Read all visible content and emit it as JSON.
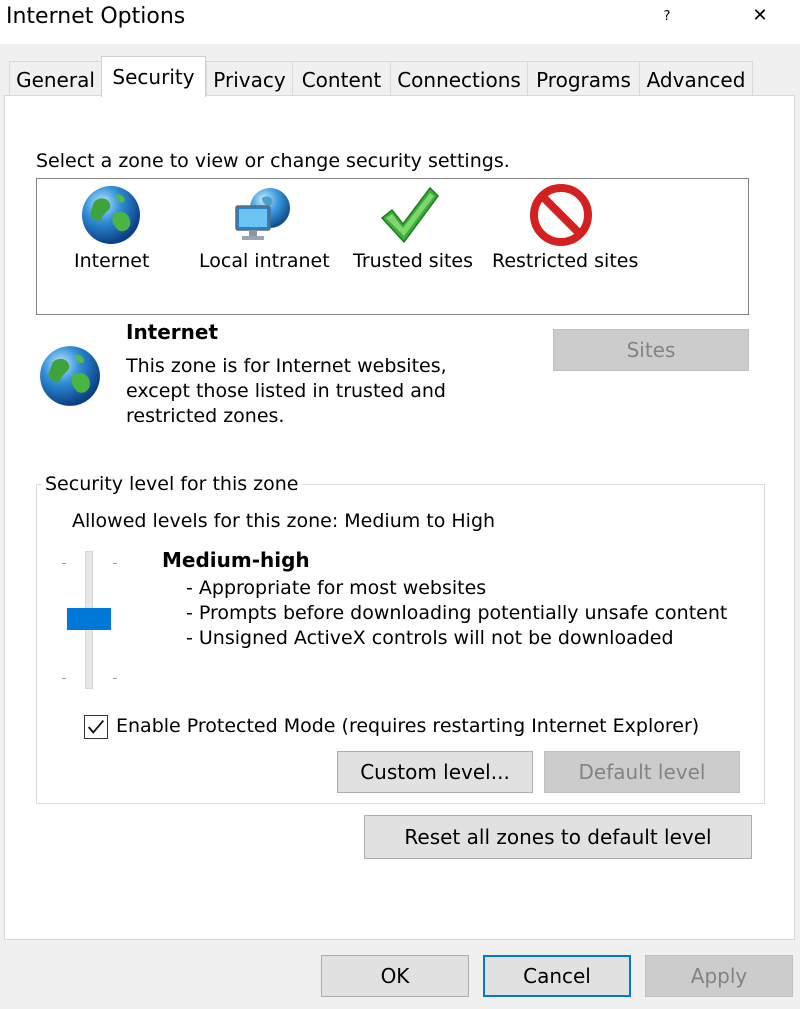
{
  "window": {
    "title": "Internet Options",
    "help_label": "?",
    "close_label": "✕"
  },
  "tabs": [
    {
      "label": "General"
    },
    {
      "label": "Security"
    },
    {
      "label": "Privacy"
    },
    {
      "label": "Content"
    },
    {
      "label": "Connections"
    },
    {
      "label": "Programs"
    },
    {
      "label": "Advanced"
    }
  ],
  "active_tab": "Security",
  "security": {
    "zone_prompt": "Select a zone to view or change security settings.",
    "zones": [
      {
        "label": "Internet",
        "icon": "globe-icon",
        "selected": true
      },
      {
        "label": "Local intranet",
        "icon": "intranet-monitor-icon"
      },
      {
        "label": "Trusted sites",
        "icon": "checkmark-icon"
      },
      {
        "label": "Restricted sites",
        "icon": "prohibited-icon"
      }
    ],
    "selected_zone": {
      "name": "Internet",
      "description_lines": [
        "This zone is for Internet websites,",
        "except those listed in trusted and",
        "restricted zones."
      ]
    },
    "sites_button": "Sites",
    "level_group": {
      "title": "Security level for this zone",
      "allowed_levels": "Allowed levels for this zone: Medium to High",
      "level_name": "Medium-high",
      "level_points": [
        "- Appropriate for most websites",
        "- Prompts before downloading potentially unsafe content",
        "- Unsigned ActiveX controls will not be downloaded"
      ],
      "slider_position_label": "Medium-high",
      "protected_mode_label": "Enable Protected Mode (requires restarting Internet Explorer)",
      "protected_mode_checked": true,
      "custom_level_button": "Custom level...",
      "default_level_button": "Default level"
    },
    "reset_all_button": "Reset all zones to default level"
  },
  "footer": {
    "ok": "OK",
    "cancel": "Cancel",
    "apply": "Apply"
  },
  "colors": {
    "accent": "#0078d7",
    "disabled_text": "#838383"
  }
}
